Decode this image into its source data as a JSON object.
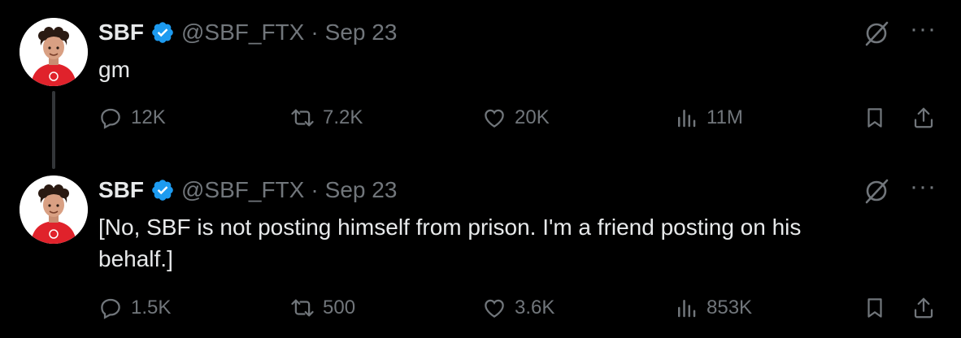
{
  "colors": {
    "background": "#000000",
    "text": "#e7e9ea",
    "muted": "#71767b",
    "verified": "#1d9bf0",
    "avatar_shirt": "#e0222b"
  },
  "tweets": [
    {
      "display_name": "SBF",
      "handle": "@SBF_FTX",
      "separator": "·",
      "date": "Sep 23",
      "text": "gm",
      "stats": {
        "replies": "12K",
        "reposts": "7.2K",
        "likes": "20K",
        "views": "11M"
      }
    },
    {
      "display_name": "SBF",
      "handle": "@SBF_FTX",
      "separator": "·",
      "date": "Sep 23",
      "text": "[No, SBF is not posting himself from prison. I'm a friend posting on his behalf.]",
      "stats": {
        "replies": "1.5K",
        "reposts": "500",
        "likes": "3.6K",
        "views": "853K"
      }
    }
  ],
  "icons": [
    "verified-badge-icon",
    "grok-icon",
    "more-icon",
    "reply-icon",
    "repost-icon",
    "like-icon",
    "views-icon",
    "bookmark-icon",
    "share-icon"
  ]
}
